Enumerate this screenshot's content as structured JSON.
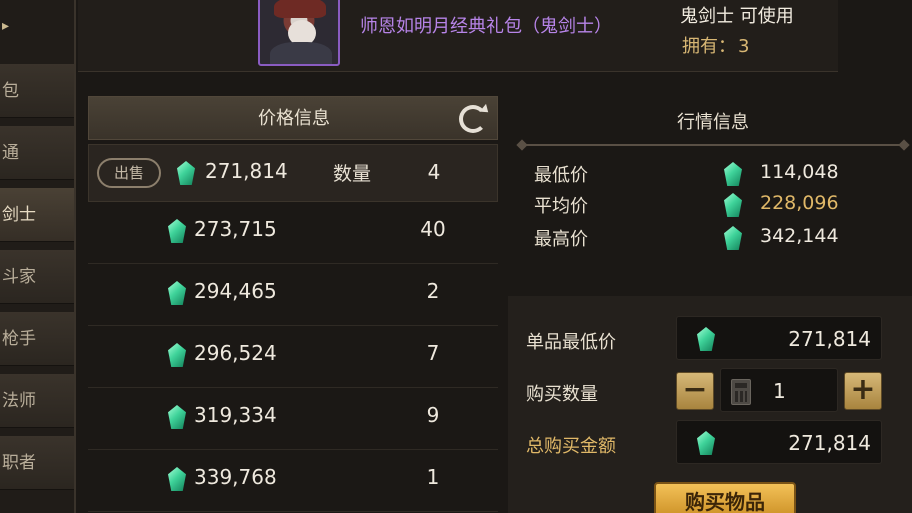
{
  "sidebar": {
    "items": [
      {
        "label": "包",
        "active": false
      },
      {
        "label": "通",
        "active": false
      },
      {
        "label": "剑士",
        "active": true
      },
      {
        "label": "斗家",
        "active": false
      },
      {
        "label": "枪手",
        "active": false
      },
      {
        "label": "法师",
        "active": false
      },
      {
        "label": "职者",
        "active": false
      }
    ]
  },
  "header": {
    "item_name": "师恩如明月经典礼包（鬼剑士）",
    "usable_text": "鬼剑士 可使用",
    "owned_label": "拥有：",
    "owned_count": "3"
  },
  "price_panel": {
    "title": "价格信息",
    "sell_label": "出售",
    "qty_label": "数量",
    "listings": [
      {
        "price": "271,814",
        "qty": "4"
      },
      {
        "price": "273,715",
        "qty": "40"
      },
      {
        "price": "294,465",
        "qty": "2"
      },
      {
        "price": "296,524",
        "qty": "7"
      },
      {
        "price": "319,334",
        "qty": "9"
      },
      {
        "price": "339,768",
        "qty": "1"
      }
    ]
  },
  "market": {
    "title": "行情信息",
    "lowest_label": "最低价",
    "lowest_value": "114,048",
    "average_label": "平均价",
    "average_value": "228,096",
    "highest_label": "最高价",
    "highest_value": "342,144"
  },
  "purchase": {
    "unit_min_label": "单品最低价",
    "unit_min_value": "271,814",
    "quantity_label": "购买数量",
    "minus_symbol": "−",
    "plus_symbol": "+",
    "quantity_value": "1",
    "total_label": "总购买金额",
    "total_value": "271,814",
    "buy_button": "购买物品"
  },
  "colors": {
    "gem": "#3fd39a",
    "gold_text": "#e0b868",
    "item_name": "#b784e8",
    "button_gold": "#f3c158"
  }
}
